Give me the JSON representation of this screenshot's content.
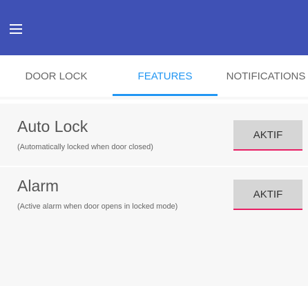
{
  "appbar": {
    "color": "#3f51b5",
    "menu_icon": "hamburger-menu-icon"
  },
  "tabs": [
    {
      "label": "DOOR LOCK",
      "active": false
    },
    {
      "label": "FEATURES",
      "active": true
    },
    {
      "label": "NOTIFICATIONS",
      "active": false
    }
  ],
  "colors": {
    "active_tab": "#2196f3",
    "button_underline": "#e91e63",
    "button_bg": "#d6d6d6"
  },
  "features": [
    {
      "title": "Auto Lock",
      "subtitle": "(Automatically locked when door closed)",
      "button_label": "AKTIF"
    },
    {
      "title": "Alarm",
      "subtitle": "(Active alarm when door opens in locked mode)",
      "button_label": "AKTIF"
    }
  ]
}
